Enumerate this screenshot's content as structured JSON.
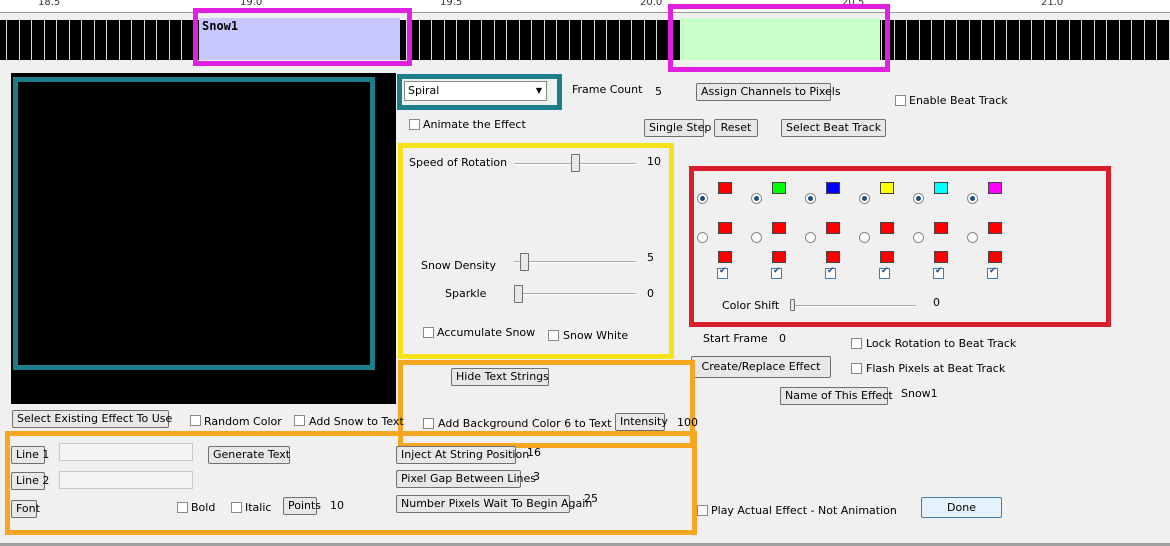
{
  "timeline": {
    "ruler_labels": [
      "18.5",
      "19.0",
      "19.5",
      "20.0",
      "20.5",
      "21.0"
    ],
    "clip1_label": "Snow1",
    "colors": {
      "clip1": "#c8c8ff",
      "clip2": "#c8ffc8",
      "track": "#000000"
    }
  },
  "effect_select": {
    "value": "Spiral"
  },
  "frame_count": {
    "label": "Frame Count",
    "value": "5"
  },
  "buttons": {
    "assign_channels": "Assign Channels to Pixels",
    "single_step": "Single Step",
    "reset": "Reset",
    "select_beat_track": "Select Beat Track",
    "hide_text_strings": "Hide Text Strings",
    "intensity": "Intensity",
    "select_existing_effect": "Select Existing Effect To Use",
    "line1": "Line 1",
    "line2": "Line 2",
    "font": "Font",
    "generate_text": "Generate Text",
    "points": "Points",
    "inject_at_string": "Inject At String Position",
    "pixel_gap": "Pixel Gap Between Lines",
    "number_pixels_wait": "Number Pixels Wait To Begin Again",
    "create_replace": "Create/Replace Effect",
    "name_of_effect": "Name of This Effect",
    "done": "Done"
  },
  "checkboxes": {
    "enable_beat_track": "Enable Beat Track",
    "animate_effect": "Animate the Effect",
    "accumulate_snow": "Accumulate Snow",
    "snow_white": "Snow White",
    "random_color": "Random Color",
    "add_snow_to_text": "Add Snow to Text",
    "add_background_color": "Add Background Color 6 to Text",
    "bold": "Bold",
    "italic": "Italic",
    "lock_rotation": "Lock Rotation to Beat Track",
    "flash_pixels": "Flash Pixels at Beat Track",
    "play_actual": "Play Actual Effect - Not Animation"
  },
  "sliders": {
    "speed_of_rotation": {
      "label": "Speed of Rotation",
      "value": "10",
      "fraction": 0.5
    },
    "snow_density": {
      "label": "Snow Density",
      "value": "5",
      "fraction": 0.05
    },
    "sparkle": {
      "label": "Sparkle",
      "value": "0",
      "fraction": 0.0
    },
    "color_shift": {
      "label": "Color Shift",
      "value": "0",
      "fraction": 0.0
    }
  },
  "values": {
    "intensity": "100",
    "points": "10",
    "inject_at_string": "16",
    "pixel_gap": "3",
    "number_pixels_wait": "25",
    "start_frame_label": "Start Frame",
    "start_frame_value": "0",
    "effect_name": "Snow1"
  },
  "palette": {
    "row1": [
      "#ff0000",
      "#00ff00",
      "#0000ff",
      "#ffff00",
      "#00ffff",
      "#ff00ff"
    ],
    "row2": [
      "#ff0000",
      "#ff0000",
      "#ff0000",
      "#ff0000",
      "#ff0000",
      "#ff0000"
    ],
    "row3": [
      "#ff0000",
      "#ff0000",
      "#ff0000",
      "#ff0000",
      "#ff0000",
      "#ff0000"
    ]
  },
  "highlights": {
    "magenta": "#e020e0",
    "teal": "#1a7f8a",
    "yellow": "#f5e21a",
    "red": "#d81e2a",
    "orange": "#f5a623"
  }
}
